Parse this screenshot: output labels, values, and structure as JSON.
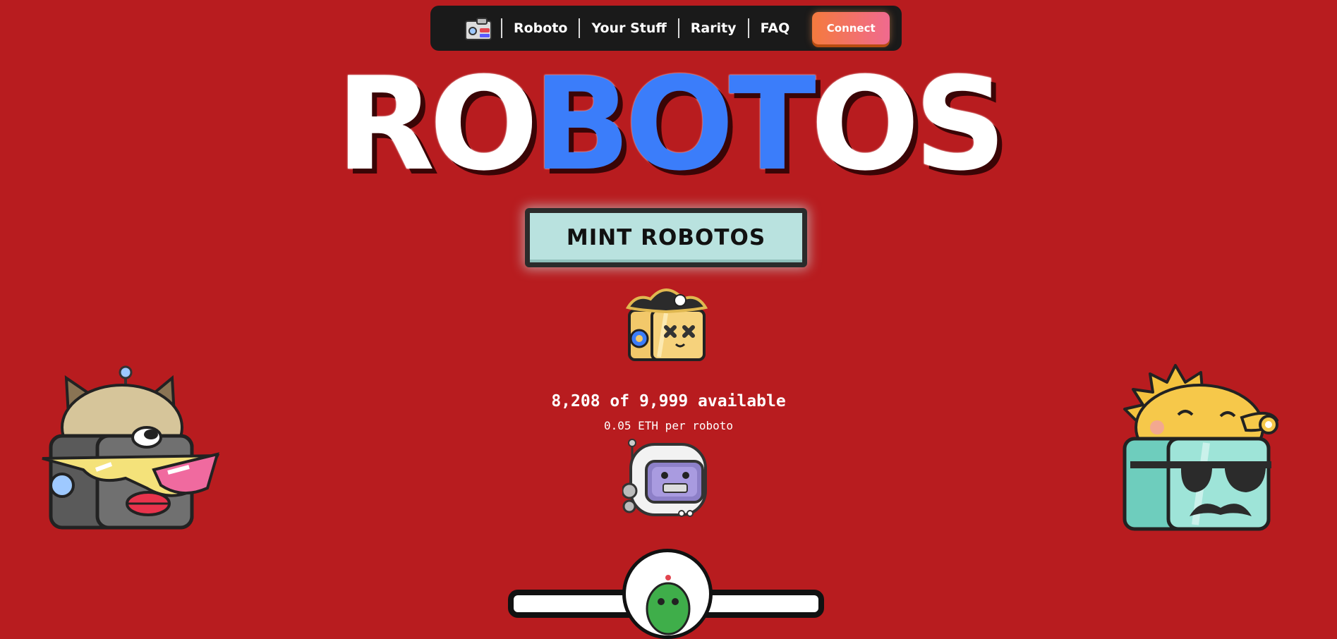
{
  "nav": {
    "logo_icon": "camera-robot-icon",
    "links": [
      "Roboto",
      "Your Stuff",
      "Rarity",
      "FAQ"
    ],
    "connect_label": "Connect"
  },
  "title": {
    "letters": [
      "R",
      "O",
      "B",
      "O",
      "T",
      "O",
      "S"
    ],
    "highlight_colors": {
      "white": "#ffffff",
      "blue": "#3b7dfa"
    }
  },
  "mint": {
    "label": "MINT ROBOTOS"
  },
  "supply": {
    "availability_text": "8,208 of 9,999 available",
    "price_text": "0.05 ETH per roboto"
  },
  "colors": {
    "background": "#b81c1f",
    "nav_bg": "#1a1a1a",
    "mint_bg": "#b9e2df",
    "connect_gradient_start": "#f47a3e",
    "connect_gradient_end": "#f06a8f"
  },
  "icons": {
    "pirate_robot": "pirate-robot-icon",
    "astronaut_robot": "astronaut-robot-icon",
    "dog_robot": "dog-robot-icon",
    "sun_robot": "sun-robot-icon",
    "green_robot": "green-robot-icon"
  }
}
